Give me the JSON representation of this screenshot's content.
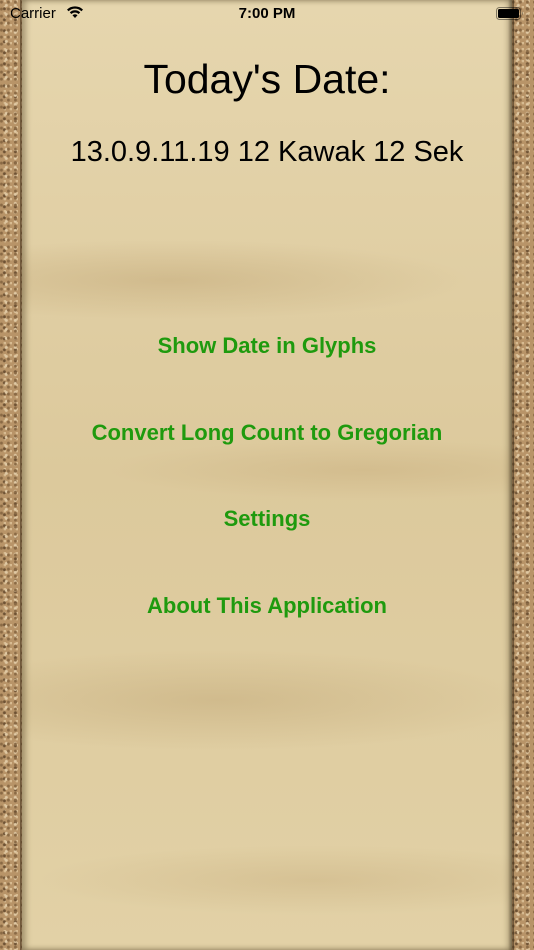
{
  "status_bar": {
    "carrier": "Carrier",
    "time": "7:00 PM",
    "wifi_icon": "wifi-icon",
    "battery_icon": "battery-icon"
  },
  "main": {
    "title": "Today's Date:",
    "date_value": "13.0.9.11.19 12 Kawak 12 Sek"
  },
  "menu": {
    "show_glyphs": "Show Date in Glyphs",
    "convert": "Convert Long Count to Gregorian",
    "settings": "Settings",
    "about": "About This Application"
  },
  "colors": {
    "link": "#1f9a0e",
    "text": "#000000",
    "panel": "#e3d2a8",
    "border": "#b89468"
  }
}
